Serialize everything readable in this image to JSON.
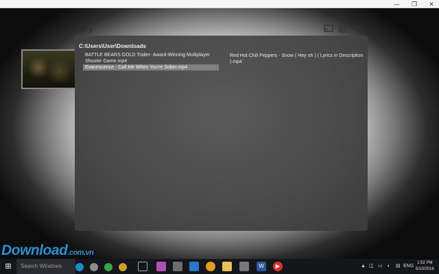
{
  "window": {
    "minimize_icon": "—",
    "restore_icon": "❐",
    "close_icon": "✕"
  },
  "toolbar": {
    "help_label": "?",
    "settings_icon": "gear-icon",
    "cast_icon": "cast-icon",
    "playlist_icon": "playlist-icon",
    "repeat_icon": "repeat-icon"
  },
  "browser": {
    "path": "C:\\Users\\User\\Downloads",
    "files": [
      {
        "name": "BATTLE BEARS GOLD Trailer- Award-Winning Multiplayer Shooter Game.mp4",
        "selected": false
      },
      {
        "name": "Evanescence - Call Me When You're Sober.mp4",
        "selected": true
      },
      {
        "name": "Red Hot Chili Peppers - Snow ( Hey oh ) ( Lyrics in Description ).mp4",
        "selected": false
      }
    ]
  },
  "watermark": {
    "text": "Download",
    "suffix": ".com.vn"
  },
  "taskbar": {
    "search_placeholder": "Search Windows",
    "language": "ENG",
    "time": "1:52 PM",
    "date": "5/10/2016",
    "colors": {
      "circle_1": "#1e88c8",
      "circle_2": "#8d8d8d",
      "circle_3": "#3aa24b",
      "circle_4": "#c7a02a",
      "record_button": "#d9302c"
    }
  }
}
